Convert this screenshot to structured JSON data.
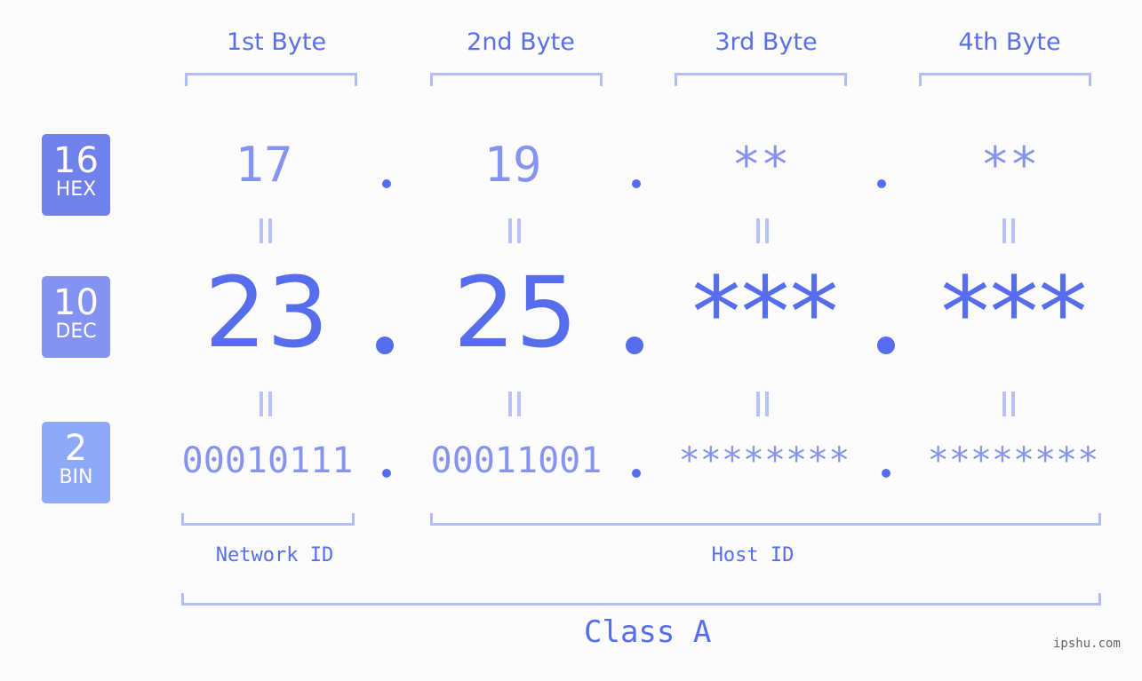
{
  "bytes": {
    "headers": [
      "1st Byte",
      "2nd Byte",
      "3rd Byte",
      "4th Byte"
    ]
  },
  "badges": {
    "hex": {
      "num": "16",
      "label": "HEX",
      "color": "#7181ec"
    },
    "dec": {
      "num": "10",
      "label": "DEC",
      "color": "#8493f1"
    },
    "bin": {
      "num": "2",
      "label": "BIN",
      "color": "#8ea9f8"
    }
  },
  "ip": {
    "hex": [
      "17",
      "19",
      "**",
      "**"
    ],
    "dec": [
      "23",
      "25",
      "***",
      "***"
    ],
    "bin": [
      "00010111",
      "00011001",
      "********",
      "********"
    ],
    "separator": "."
  },
  "ids": {
    "network": "Network ID",
    "host": "Host ID"
  },
  "class_label": "Class A",
  "watermark": "ipshu.com",
  "colors": {
    "primary": "#566ded",
    "light": "#8794ef",
    "bracket": "#b4bdf6"
  }
}
